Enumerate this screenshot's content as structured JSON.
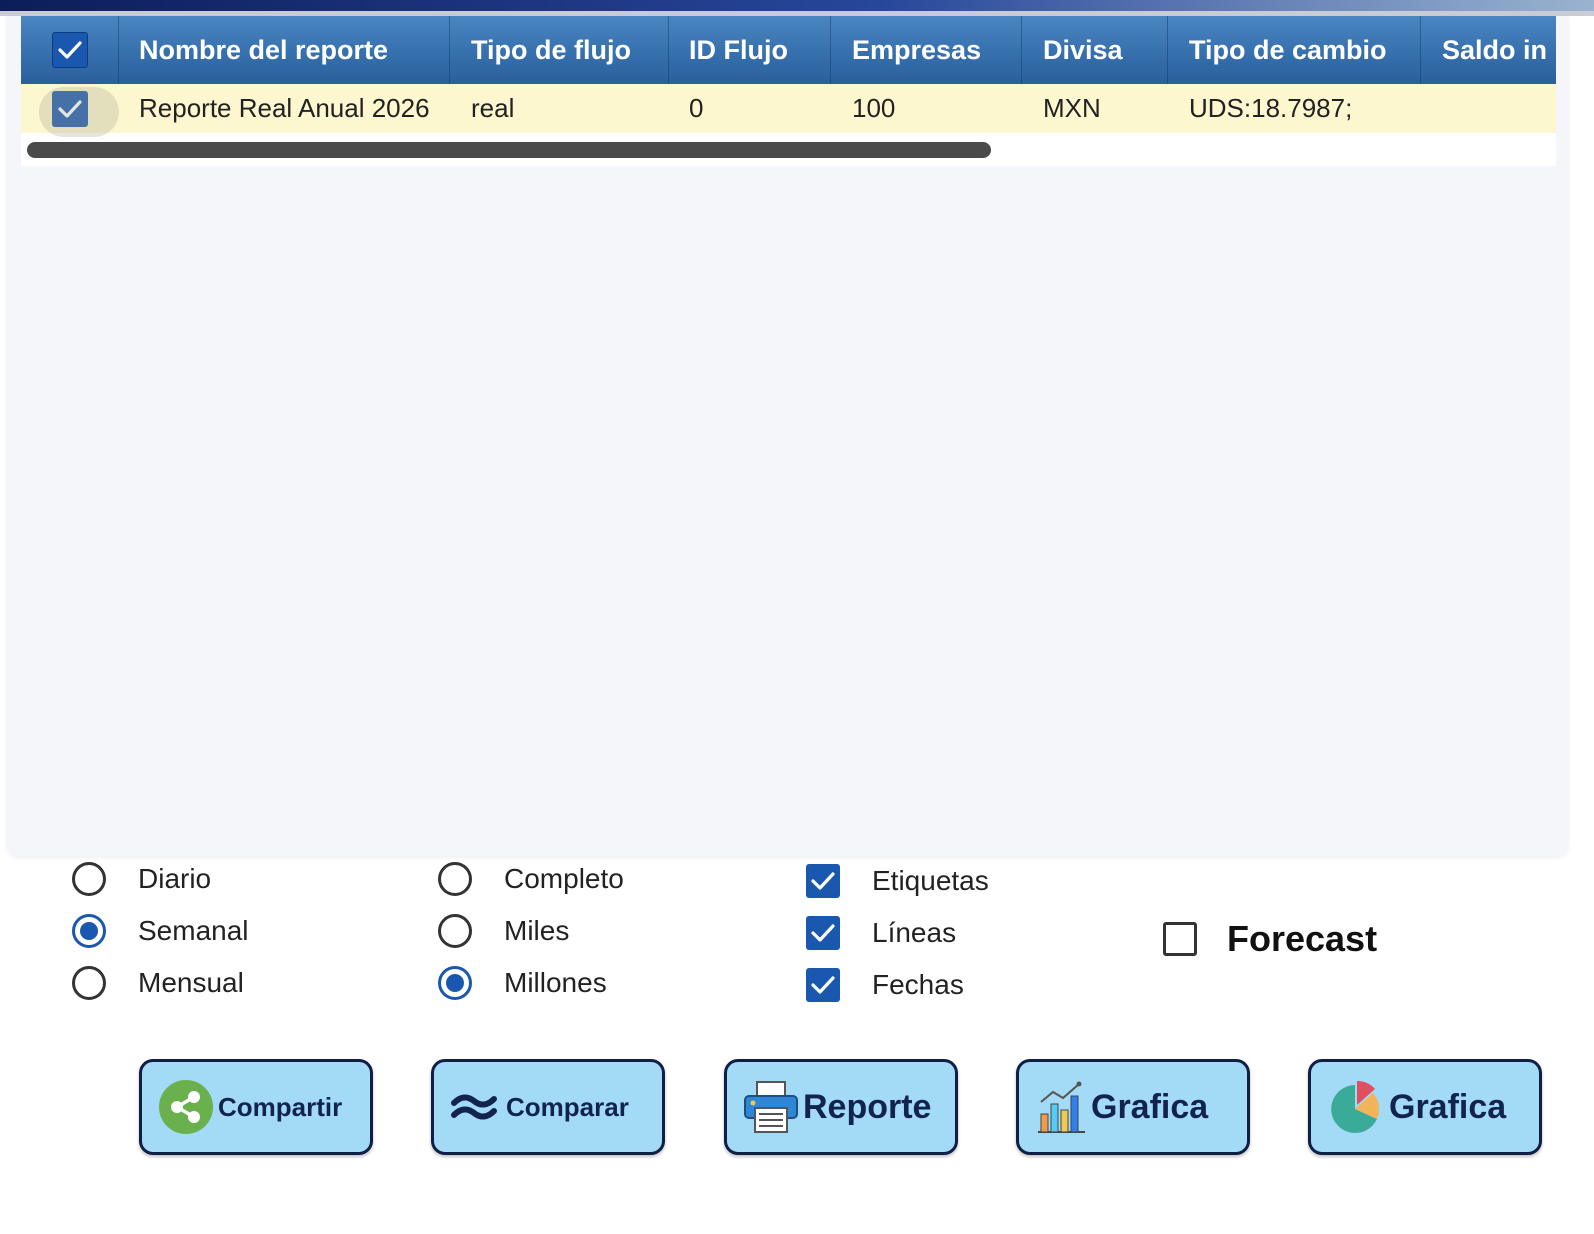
{
  "table": {
    "columns": [
      "Nombre del reporte",
      "Tipo de flujo",
      "ID Flujo",
      "Empresas",
      "Divisa",
      "Tipo de cambio",
      "Saldo in"
    ],
    "header_checked": true,
    "rows": [
      {
        "checked": true,
        "cells": [
          "Reporte Real Anual 2026",
          "real",
          "0",
          "100",
          "MXN",
          "UDS:18.7987;",
          ""
        ]
      }
    ]
  },
  "options": {
    "periodicity": {
      "items": [
        "Diario",
        "Semanal",
        "Mensual"
      ],
      "selected": "Semanal"
    },
    "units": {
      "items": [
        "Completo",
        "Miles",
        "Millones"
      ],
      "selected": "Millones"
    },
    "display": {
      "items": [
        "Etiquetas",
        "Líneas",
        "Fechas"
      ],
      "checked": [
        true,
        true,
        true
      ]
    },
    "forecast": {
      "label": "Forecast",
      "checked": false
    }
  },
  "buttons": {
    "compartir": "Compartir",
    "comparar": "Comparar",
    "reporte": "Reporte",
    "grafica_bar": "Grafica",
    "grafica_pie": "Grafica"
  },
  "icons": {
    "compartir": "share-icon",
    "comparar": "waves-icon",
    "reporte": "printer-icon",
    "grafica_bar": "bar-chart-icon",
    "grafica_pie": "pie-chart-icon"
  },
  "colors": {
    "header_blue": "#3670ad",
    "row_highlight": "#fdf7cf",
    "control_blue": "#1a58b0",
    "button_bg": "#a3daf6",
    "button_border": "#0f1f45"
  }
}
